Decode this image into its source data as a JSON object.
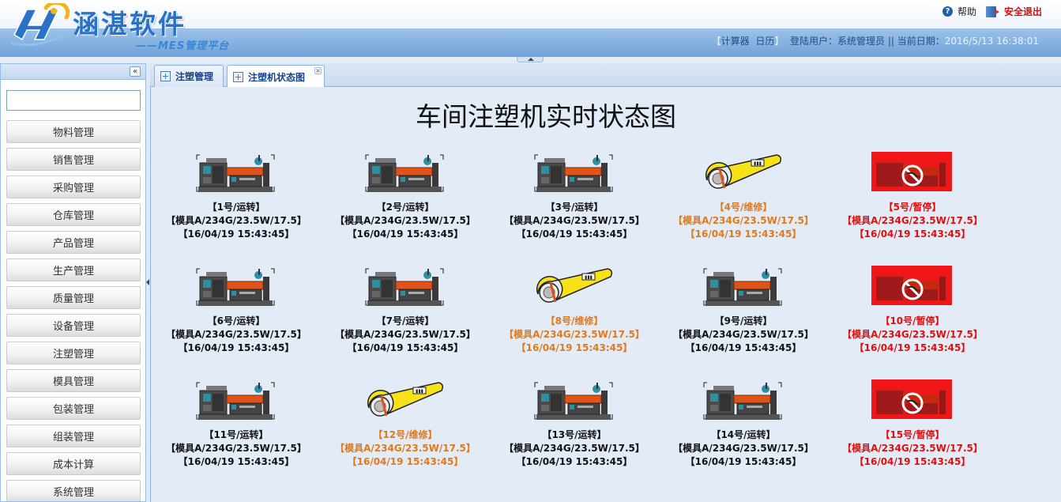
{
  "brand": {
    "title": "涵湛软件",
    "subtitle": "——MES管理平台"
  },
  "top_links": {
    "help": "帮助",
    "exit": "安全退出"
  },
  "status_bar": {
    "bracket_open": "【",
    "calculator": "计算器",
    "calendar": "日历",
    "bracket_close": "】",
    "user_label": "登陆用户：",
    "user_name": "系统管理员",
    "separator": " || ",
    "date_label": "当前日期：",
    "date_value": "2016/5/13 16:38:01"
  },
  "sidebar": {
    "collapse_glyph": "«",
    "search_value": "",
    "items": [
      {
        "label": "物料管理"
      },
      {
        "label": "销售管理"
      },
      {
        "label": "采购管理"
      },
      {
        "label": "仓库管理"
      },
      {
        "label": "产品管理"
      },
      {
        "label": "生产管理"
      },
      {
        "label": "质量管理"
      },
      {
        "label": "设备管理"
      },
      {
        "label": "注塑管理"
      },
      {
        "label": "模具管理"
      },
      {
        "label": "包装管理"
      },
      {
        "label": "组装管理"
      },
      {
        "label": "成本计算"
      },
      {
        "label": "系统管理"
      }
    ]
  },
  "tabs": [
    {
      "label": "注塑管理",
      "active": false
    },
    {
      "label": "注塑机状态图",
      "active": true
    }
  ],
  "page_title": "车间注塑机实时状态图",
  "colors": {
    "run": "#111111",
    "repair": "#e07a1a",
    "stop": "#e01010"
  },
  "machines": [
    {
      "name": "【1号/运转】",
      "mold": "【模具A/234G/23.5W/17.5】",
      "time": "【16/04/19 15:43:45】",
      "status": "run"
    },
    {
      "name": "【2号/运转】",
      "mold": "【模具A/234G/23.5W/17.5】",
      "time": "【16/04/19 15:43:45】",
      "status": "run"
    },
    {
      "name": "【3号/运转】",
      "mold": "【模具A/234G/23.5W/17.5】",
      "time": "【16/04/19 15:43:45】",
      "status": "run"
    },
    {
      "name": "【4号/维修】",
      "mold": "【模具A/234G/23.5W/17.5】",
      "time": "【16/04/19 15:43:45】",
      "status": "repair"
    },
    {
      "name": "【5号/暂停】",
      "mold": "【模具A/234G/23.5W/17.5】",
      "time": "【16/04/19 15:43:45】",
      "status": "stop"
    },
    {
      "name": "【6号/运转】",
      "mold": "【模具A/234G/23.5W/17.5】",
      "time": "【16/04/19 15:43:45】",
      "status": "run"
    },
    {
      "name": "【7号/运转】",
      "mold": "【模具A/234G/23.5W/17.5】",
      "time": "【16/04/19 15:43:45】",
      "status": "run"
    },
    {
      "name": "【8号/维修】",
      "mold": "【模具A/234G/23.5W/17.5】",
      "time": "【16/04/19 15:43:45】",
      "status": "repair"
    },
    {
      "name": "【9号/运转】",
      "mold": "【模具A/234G/23.5W/17.5】",
      "time": "【16/04/19 15:43:45】",
      "status": "run"
    },
    {
      "name": "【10号/暂停】",
      "mold": "【模具A/234G/23.5W/17.5】",
      "time": "【16/04/19 15:43:45】",
      "status": "stop"
    },
    {
      "name": "【11号/运转】",
      "mold": "【模具A/234G/23.5W/17.5】",
      "time": "【16/04/19 15:43:45】",
      "status": "run"
    },
    {
      "name": "【12号/维修】",
      "mold": "【模具A/234G/23.5W/17.5】",
      "time": "【16/04/19 15:43:45】",
      "status": "repair"
    },
    {
      "name": "【13号/运转】",
      "mold": "【模具A/234G/23.5W/17.5】",
      "time": "【16/04/19 15:43:45】",
      "status": "run"
    },
    {
      "name": "【14号/运转】",
      "mold": "【模具A/234G/23.5W/17.5】",
      "time": "【16/04/19 15:43:45】",
      "status": "run"
    },
    {
      "name": "【15号/暂停】",
      "mold": "【模具A/234G/23.5W/17.5】",
      "time": "【16/04/19 15:43:45】",
      "status": "stop"
    }
  ]
}
